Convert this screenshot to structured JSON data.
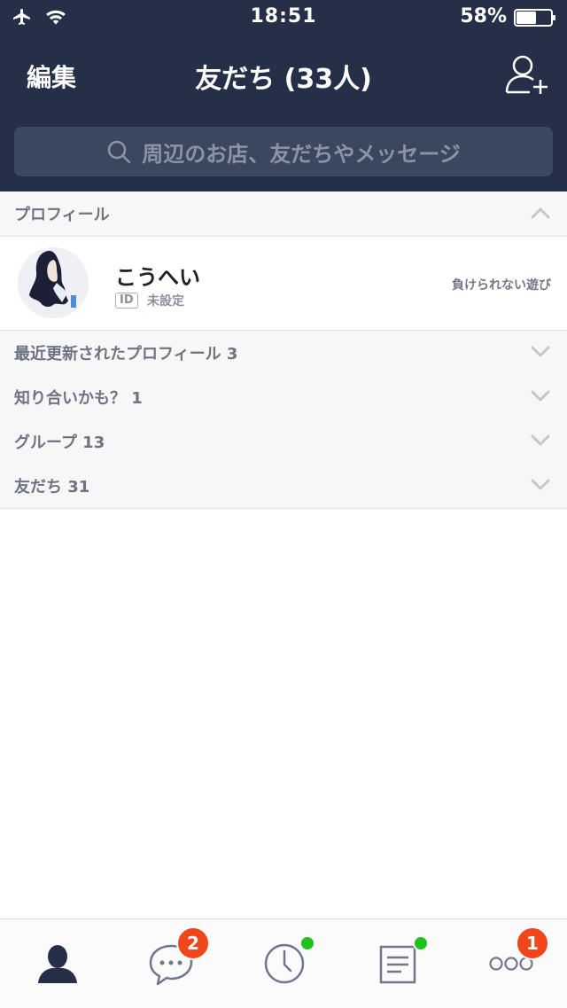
{
  "status_bar": {
    "time": "18:51",
    "battery": "58%",
    "battery_level": 0.58
  },
  "navbar": {
    "edit_label": "編集",
    "title": "友だち (33人)"
  },
  "search": {
    "placeholder": "周辺のお店、友だちやメッセージ"
  },
  "sections": {
    "profile": {
      "label": "プロフィール",
      "state": "expanded"
    },
    "recent": {
      "label": "最近更新されたプロフィール 3"
    },
    "suggestions": {
      "label": "知り合いかも？ 1"
    },
    "groups": {
      "label": "グループ 13"
    },
    "friends": {
      "label": "友だち 31"
    }
  },
  "profile": {
    "name": "こうへい",
    "id_badge": "ID",
    "id_text": "未設定",
    "status_message": "負けられない遊び"
  },
  "tabbar": {
    "tabs": [
      {
        "icon": "person-icon",
        "active": true
      },
      {
        "icon": "chat-icon",
        "badge": "2"
      },
      {
        "icon": "clock-icon",
        "dot": true
      },
      {
        "icon": "news-icon",
        "dot": true
      },
      {
        "icon": "more-icon",
        "badge": "1"
      }
    ]
  },
  "colors": {
    "header_bg": "#253048",
    "badge": "#f0461c",
    "dot": "#1ec11e"
  }
}
